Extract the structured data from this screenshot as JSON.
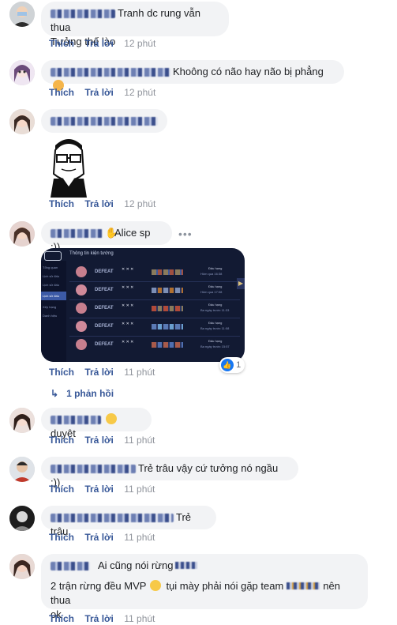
{
  "comments": [
    {
      "text": "Tranh dc rung vẫn thua",
      "text2": "Tưởng thế lào",
      "time": "12 phút"
    },
    {
      "text": "Khoông có não hay não bị phẳng",
      "time": "12 phút"
    },
    {
      "text": "",
      "time": "12 phút"
    },
    {
      "text": "Alice sp :))",
      "time": "11 phút",
      "reaction_count": "1"
    },
    {
      "text": "duyệt",
      "time": "11 phút"
    },
    {
      "text": "Trẻ trâu vậy cứ tưởng nó ngầu :))",
      "time": "11 phút"
    },
    {
      "text": "Trẻ trâu",
      "time": "11 phút"
    },
    {
      "text": "Ai cũng nói rừng",
      "text2": "2 trận rừng đều MVP",
      "text3": "tụi mày phải nói gặp team",
      "text4": "nên thua",
      "text5": "ok",
      "time": "11 phút"
    }
  ],
  "actions": {
    "like": "Thích",
    "reply": "Trả lời"
  },
  "replies_link": "1 phản hồi",
  "screenshot_card": {
    "title": "Thông tin kiện tướng",
    "sidebar": [
      "Tổng quan",
      "Lịch sử đấu",
      "Lịch sử đấu",
      "Lịch sử đấu",
      "Xếp hạng",
      "Danh hiệu"
    ],
    "rows": [
      {
        "result": "DEFEAT",
        "mode": "Đấu hạng",
        "when": "Hôm qua 16:38"
      },
      {
        "result": "DEFEAT",
        "mode": "Đấu hạng",
        "when": "Hôm qua 17:08"
      },
      {
        "result": "DEFEAT",
        "mode": "Đấu hạng",
        "when": "Ba ngày trước 11:33"
      },
      {
        "result": "DEFEAT",
        "mode": "Đấu hạng",
        "when": "Ba ngày trước 11:08"
      },
      {
        "result": "DEFEAT",
        "mode": "Đấu hạng",
        "when": "Ba ngày trước 15:57"
      }
    ]
  },
  "colors": {
    "link": "#385898",
    "muted": "#90949c",
    "bubble": "#f2f3f5"
  }
}
